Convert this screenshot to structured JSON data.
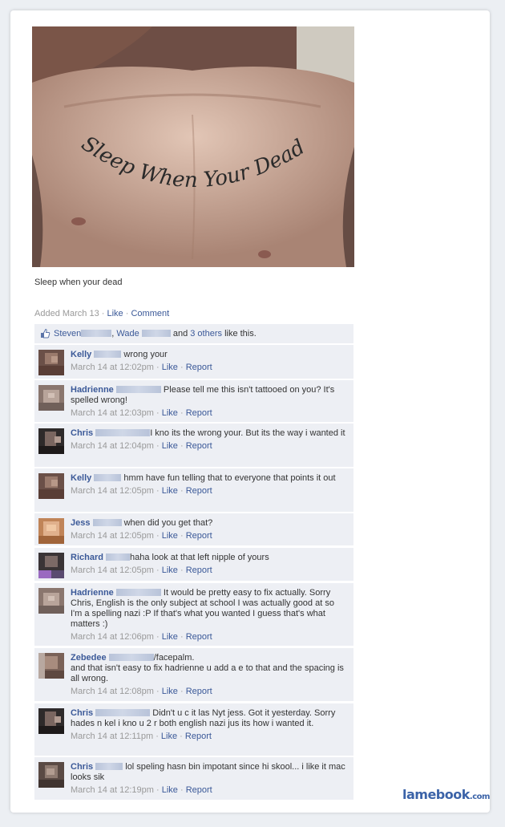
{
  "photo": {
    "tattoo_text": "Sleep When Your Dead",
    "caption": "Sleep when your dead"
  },
  "meta": {
    "added": "Added March 13",
    "like": "Like",
    "comment": "Comment"
  },
  "likes": {
    "name1": "Steven",
    "name2": "Wade",
    "and": "and",
    "others": "3 others",
    "suffix": "like this."
  },
  "comments": [
    {
      "name": "Kelly",
      "text": "wrong your",
      "time": "March 14 at 12:02pm"
    },
    {
      "name": "Hadrienne",
      "text": "Please tell me this isn't tattooed on you? It's spelled wrong!",
      "time": "March 14 at 12:03pm"
    },
    {
      "name": "Chris",
      "text": "I kno its the wrong your. But its the way i wanted it",
      "time": "March 14 at 12:04pm"
    },
    {
      "name": "Kelly",
      "text": "hmm have fun telling that to everyone that points it out",
      "time": "March 14 at 12:05pm"
    },
    {
      "name": "Jess",
      "text": "when did you get that?",
      "time": "March 14 at 12:05pm"
    },
    {
      "name": "Richard",
      "text": "haha look at that left nipple of yours",
      "time": "March 14 at 12:05pm"
    },
    {
      "name": "Hadrienne",
      "text": "It would be pretty easy to fix actually. Sorry Chris, English is the only subject at school I was actually good at so I'm a spelling nazi :P If that's what you wanted I guess that's what matters :)",
      "time": "March 14 at 12:06pm"
    },
    {
      "name": "Zebedee",
      "text": "/facepalm.",
      "text2": "and that isn't easy to fix hadrienne u add a e to that and the spacing is all wrong.",
      "time": "March 14 at 12:08pm"
    },
    {
      "name": "Chris",
      "text": "Didn't u c it las Nyt jess. Got it yesterday. Sorry hades n kel i kno u 2 r both english nazi jus its how i wanted it.",
      "time": "March 14 at 12:11pm"
    },
    {
      "name": "Chris",
      "text": "lol speling hasn bin impotant since hi skool... i like it mac looks sik",
      "time": "March 14 at 12:19pm"
    }
  ],
  "action_like": "Like",
  "action_report": "Report",
  "logo": {
    "main": "lamebook",
    "suffix": ".com"
  }
}
